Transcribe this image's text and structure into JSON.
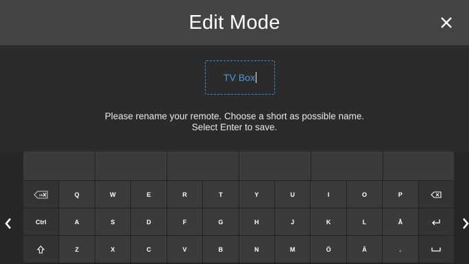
{
  "header": {
    "title": "Edit Mode"
  },
  "name_field": {
    "value": "TV Box"
  },
  "instructions": {
    "line1": "Please rename your remote. Choose a short as possible name.",
    "line2": "Select Enter to save."
  },
  "keyboard": {
    "rows": [
      [
        "",
        "Q",
        "W",
        "E",
        "R",
        "T",
        "Y",
        "U",
        "I",
        "O",
        "P",
        ""
      ],
      [
        "Ctrl",
        "A",
        "S",
        "D",
        "F",
        "G",
        "H",
        "J",
        "K",
        "L",
        "Å",
        ""
      ],
      [
        "",
        "Z",
        "X",
        "C",
        "V",
        "B",
        "N",
        "M",
        "Ö",
        "Ä",
        ".",
        ""
      ]
    ]
  },
  "colors": {
    "header_bg": "#444444",
    "accent": "#3a8fcc",
    "key_bg": "#3b3b3b"
  }
}
